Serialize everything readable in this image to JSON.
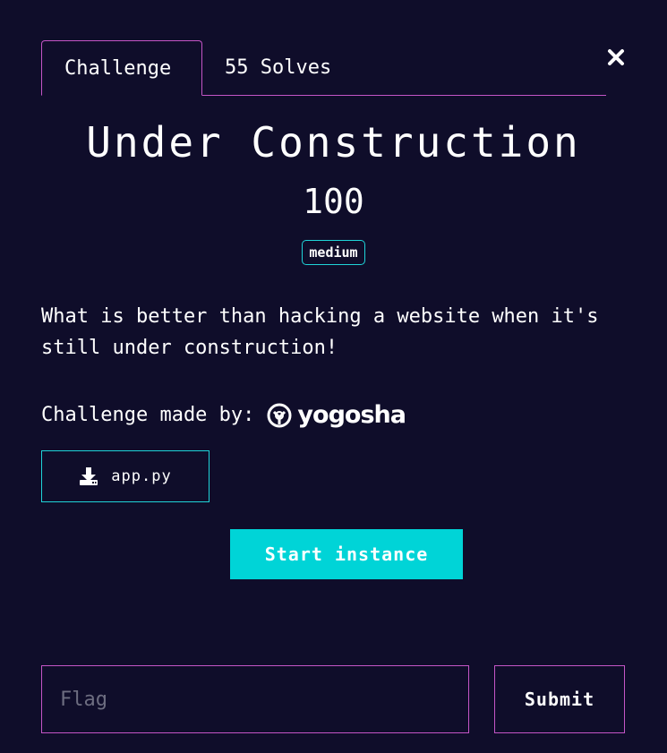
{
  "tabs": [
    {
      "label": "Challenge",
      "active": true
    },
    {
      "label": "55 Solves",
      "active": false
    }
  ],
  "close_icon": "close-icon",
  "challenge": {
    "title": "Under Construction",
    "points": "100",
    "difficulty": "medium",
    "description": "What is better than hacking a website when it's still under construction!",
    "made_by_label": "Challenge made by:",
    "author_logo_text": "yogosha"
  },
  "file": {
    "name": "app.py",
    "icon": "download-icon"
  },
  "start_button": "Start instance",
  "flag": {
    "placeholder": "Flag",
    "value": ""
  },
  "submit_button": "Submit",
  "colors": {
    "background": "#0f0d2a",
    "magenta_border": "#c455c6",
    "cyan_accent": "#00d4d7"
  }
}
